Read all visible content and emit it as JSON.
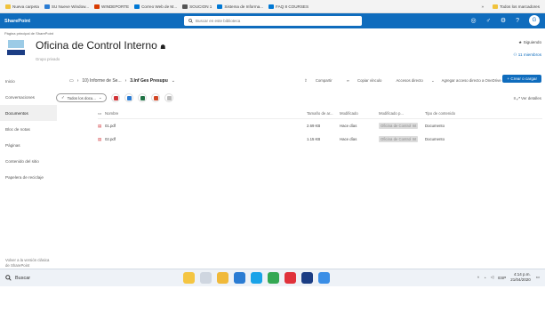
{
  "bookmarks": {
    "items": [
      {
        "label": "Nueva carpeta",
        "color": "#f0c23b"
      },
      {
        "label": "SU Nueve Window...",
        "color": "#2b7cd3"
      },
      {
        "label": "WINDEPORTE",
        "color": "#d83b01"
      },
      {
        "label": "Correo Web de M...",
        "color": "#0078d4"
      },
      {
        "label": "SOUCION 1",
        "color": "#555555"
      },
      {
        "label": "Sistema de Informa...",
        "color": "#0078d4"
      },
      {
        "label": "FAQ 8 COURSES",
        "color": "#0078d4"
      }
    ],
    "right_label": "Todos los marcadores"
  },
  "suitebar": {
    "brand": "SharePoint",
    "search_placeholder": "Buscar en este biblioteca",
    "icons": [
      "chat-icon",
      "settings-icon",
      "help-icon"
    ],
    "avatar": "G"
  },
  "site": {
    "breadcrumb": "Página principal de SharePoint",
    "title": "Oficina de Control Interno",
    "group": "Grupo privado",
    "follow": "Siguiendo",
    "members": "11 miembros"
  },
  "nav": {
    "items": [
      {
        "label": "Inicio",
        "selected": false
      },
      {
        "label": "Conversaciones",
        "selected": false
      },
      {
        "label": "Documentos",
        "selected": true
      },
      {
        "label": "Bloc de notas",
        "selected": false
      },
      {
        "label": "Páginas",
        "selected": false
      },
      {
        "label": "Contenido del sitio",
        "selected": false
      },
      {
        "label": "Papelera de reciclaje",
        "selected": false
      }
    ],
    "back_link": "Volver a la versión clásica de SharePoint"
  },
  "commandbar": {
    "crumb1": "10) Informe de Se...",
    "crumb2": "3.Inf Ges Presupu",
    "actions": [
      "Compartir",
      "Copiar vínculo",
      "Accesos directo",
      "Agregar acceso directo a OneDrive"
    ],
    "new_button": "Crear o cargar"
  },
  "filter": {
    "label": "Todos los docu...",
    "right": "Ver detalles"
  },
  "table": {
    "headers": [
      "Nombre",
      "Tamaño de ar...",
      "Modificado",
      "Modificado p...",
      "Tipo de contenido"
    ],
    "rows": [
      {
        "name": "01.pdf",
        "size": "2.69 KB",
        "modified": "Hace días",
        "by": "Oficina de Control Int",
        "type": "Documento"
      },
      {
        "name": "02.pdf",
        "size": "1.15 KB",
        "modified": "Hace días",
        "by": "Oficina de Control Int",
        "type": "Documento"
      }
    ]
  },
  "taskbar": {
    "search": "Buscar",
    "language": "ESP",
    "time": "4:14 p.m.",
    "date": "21/04/2020"
  }
}
